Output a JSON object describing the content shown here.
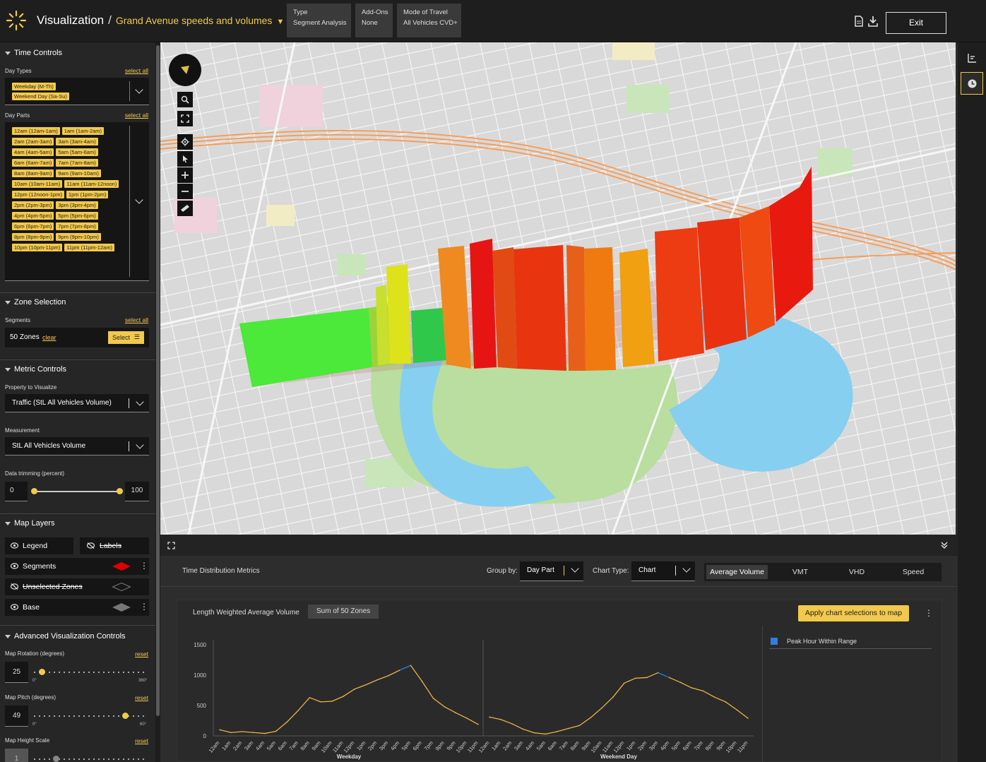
{
  "header": {
    "app_title": "Visualization",
    "separator": "/",
    "project_title": "Grand Avenue speeds and volumes",
    "info": [
      {
        "label": "Type",
        "value": "Segment Analysis"
      },
      {
        "label": "Add-Ons",
        "value": "None"
      },
      {
        "label": "Mode of Travel",
        "value": "All Vehicles CVD+"
      }
    ],
    "exit_label": "Exit"
  },
  "time_controls": {
    "title": "Time Controls",
    "day_types_label": "Day Types",
    "day_parts_label": "Day Parts",
    "select_all": "select all",
    "day_types": [
      "Weekday (M-Th)",
      "Weekend Day (Sa-Su)"
    ],
    "day_parts": [
      "12am (12am-1am)",
      "1am (1am-2am)",
      "2am (2am-3am)",
      "3am (3am-4am)",
      "4am (4am-5am)",
      "5am (5am-6am)",
      "6am (6am-7am)",
      "7am (7am-8am)",
      "8am (8am-9am)",
      "9am (9am-10am)",
      "10am (10am-11am)",
      "11am (11am-12noon)",
      "12pm (12noon-1pm)",
      "1pm (1pm-2pm)",
      "2pm (2pm-3pm)",
      "3pm (3pm-4pm)",
      "4pm (4pm-5pm)",
      "5pm (5pm-6pm)",
      "6pm (6pm-7pm)",
      "7pm (7pm-8pm)",
      "8pm (8pm-9pm)",
      "9pm (9pm-10pm)",
      "10pm (10pm-11pm)",
      "11pm (11pm-12am)"
    ]
  },
  "zone_selection": {
    "title": "Zone Selection",
    "segments_label": "Segments",
    "select_all": "select all",
    "zones_value": "50 Zones",
    "clear": "clear",
    "select_btn": "Select"
  },
  "metric_controls": {
    "title": "Metric Controls",
    "property_label": "Property to Visualize",
    "property_value": "Traffic (StL All Vehicles Volume)",
    "measurement_label": "Measurement",
    "measurement_value": "StL All Vehicles Volume",
    "trim_label": "Data trimming (percent)",
    "trim_min": "0",
    "trim_max": "100",
    "trim_low": 0,
    "trim_high": 100
  },
  "map_layers": {
    "title": "Map Layers",
    "legend": "Legend",
    "labels": "Labels",
    "segments": "Segments",
    "unselected": "Unselected Zones",
    "base": "Base",
    "segments_color": "#e00000"
  },
  "advanced": {
    "title": "Advanced Visualization Controls",
    "reset": "reset",
    "rotation_label": "Map Rotation (degrees)",
    "rotation_value": "25",
    "rotation_min": "0°",
    "rotation_max": "360°",
    "pitch_label": "Map Pitch (degrees)",
    "pitch_value": "49",
    "pitch_min": "0°",
    "pitch_max": "60°",
    "height_label": "Map Height Scale",
    "height_value": "1"
  },
  "bottom": {
    "section_title": "Time Distribution Metrics",
    "group_by_label": "Group by:",
    "group_by_value": "Day Part",
    "chart_type_label": "Chart Type:",
    "chart_type_value": "Chart",
    "metric_tabs": [
      "Average Volume",
      "VMT",
      "VHD",
      "Speed"
    ],
    "active_tab": "Average Volume",
    "chart_title": "Length Weighted Average Volume",
    "chart_badge": "Sum of 50 Zones",
    "apply_btn": "Apply chart selections to map",
    "legend_item": "Peak Hour Within Range",
    "legend_color": "#2f7fe0",
    "line_color": "#e8b34a"
  },
  "chart_data": {
    "type": "line",
    "x": [
      "12am",
      "1am",
      "2am",
      "3am",
      "4am",
      "5am",
      "6am",
      "7am",
      "8am",
      "9am",
      "10am",
      "11am",
      "12pm",
      "1pm",
      "2pm",
      "3pm",
      "4pm",
      "5pm",
      "6pm",
      "7pm",
      "8pm",
      "9pm",
      "10pm",
      "11pm"
    ],
    "y_ticks": [
      "0",
      "500",
      "1000",
      "1500"
    ],
    "ylim": [
      0,
      1500
    ],
    "panels": [
      {
        "xlabel": "Weekday",
        "values": [
          100,
          55,
          70,
          55,
          40,
          75,
          230,
          420,
          630,
          560,
          570,
          650,
          770,
          840,
          920,
          990,
          1080,
          1160,
          900,
          620,
          480,
          380,
          290,
          190
        ],
        "peak_index": 16
      },
      {
        "xlabel": "Weekend Day",
        "values": [
          310,
          270,
          200,
          110,
          50,
          30,
          70,
          120,
          170,
          300,
          460,
          640,
          870,
          950,
          960,
          1040,
          960,
          880,
          790,
          740,
          640,
          560,
          430,
          290
        ],
        "peak_index": 15
      }
    ]
  }
}
